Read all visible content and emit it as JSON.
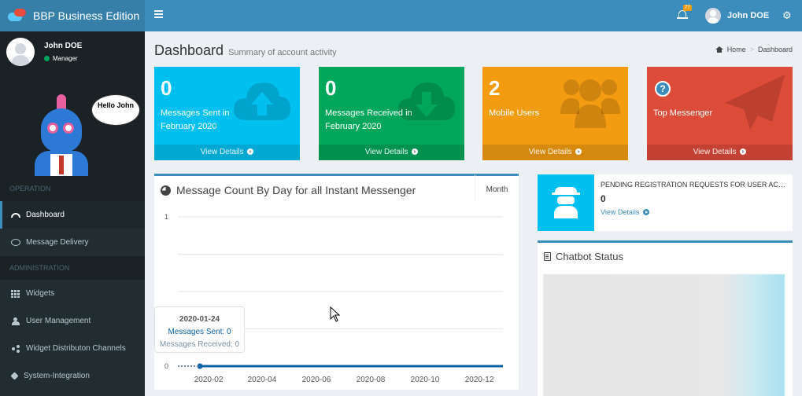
{
  "app": {
    "title": "BBP Business Edition"
  },
  "topbar": {
    "notification_count": "77",
    "user_name": "John DOE"
  },
  "sidebar": {
    "user": {
      "name": "John DOE",
      "role": "Manager"
    },
    "mascot_speech": "Hello John",
    "sections": [
      {
        "header": "OPERATION"
      },
      {
        "header": "ADMINISTRATION"
      }
    ],
    "items": [
      {
        "label": "Dashboard",
        "icon": "dashboard-icon"
      },
      {
        "label": "Message Delivery",
        "icon": "comment-icon"
      },
      {
        "label": "Widgets",
        "icon": "grid-icon"
      },
      {
        "label": "User Management",
        "icon": "users-icon"
      },
      {
        "label": "Widget Distributon Channels",
        "icon": "share-icon"
      },
      {
        "label": "System-Integration",
        "icon": "puzzle-icon"
      }
    ]
  },
  "page": {
    "title": "Dashboard",
    "subtitle": "Summary of account activity",
    "breadcrumb": [
      "Home",
      "Dashboard"
    ]
  },
  "boxes": [
    {
      "value": "0",
      "label": "Messages Sent in February 2020",
      "link": "View Details",
      "color": "#00c0ef",
      "icon": "cloud-upload-icon"
    },
    {
      "value": "0",
      "label": "Messages Received in February 2020",
      "link": "View Details",
      "color": "#00a65a",
      "icon": "cloud-download-icon"
    },
    {
      "value": "2",
      "label": "Mobile Users",
      "link": "View Details",
      "color": "#f39c12",
      "icon": "users-icon"
    },
    {
      "value": "",
      "label": "Top Messenger",
      "link": "View Details",
      "color": "#dd4b39",
      "icon": "paper-plane-icon"
    }
  ],
  "chart_panel": {
    "title": "Message Count By Day for all Instant Messenger",
    "tab": "Month",
    "tooltip": {
      "date": "2020-01-24",
      "sent": "Messages Sent: 0",
      "received": "Messages Received: 0"
    }
  },
  "chart_data": {
    "type": "line",
    "title": "Message Count By Day for all Instant Messenger",
    "xlabel": "",
    "ylabel": "",
    "ylim": [
      0,
      1
    ],
    "yticks": [
      "0",
      "1"
    ],
    "xticks": [
      "2020-02",
      "2020-04",
      "2020-06",
      "2020-08",
      "2020-10",
      "2020-12"
    ],
    "series": [
      {
        "name": "Messages Sent",
        "x": [
          "2020-01-24",
          "2020-12-31"
        ],
        "values": [
          0,
          0
        ],
        "color": "#0b62a4"
      },
      {
        "name": "Messages Received",
        "x": [
          "2020-01-24",
          "2020-12-31"
        ],
        "values": [
          0,
          0
        ],
        "color": "#7a92a3"
      }
    ],
    "grid": true
  },
  "pending": {
    "text": "PENDING REGISTRATION REQUESTS FOR USER ACCOUNTS",
    "count": "0",
    "link": "View Details"
  },
  "chatbot": {
    "title": "Chatbot Status"
  }
}
